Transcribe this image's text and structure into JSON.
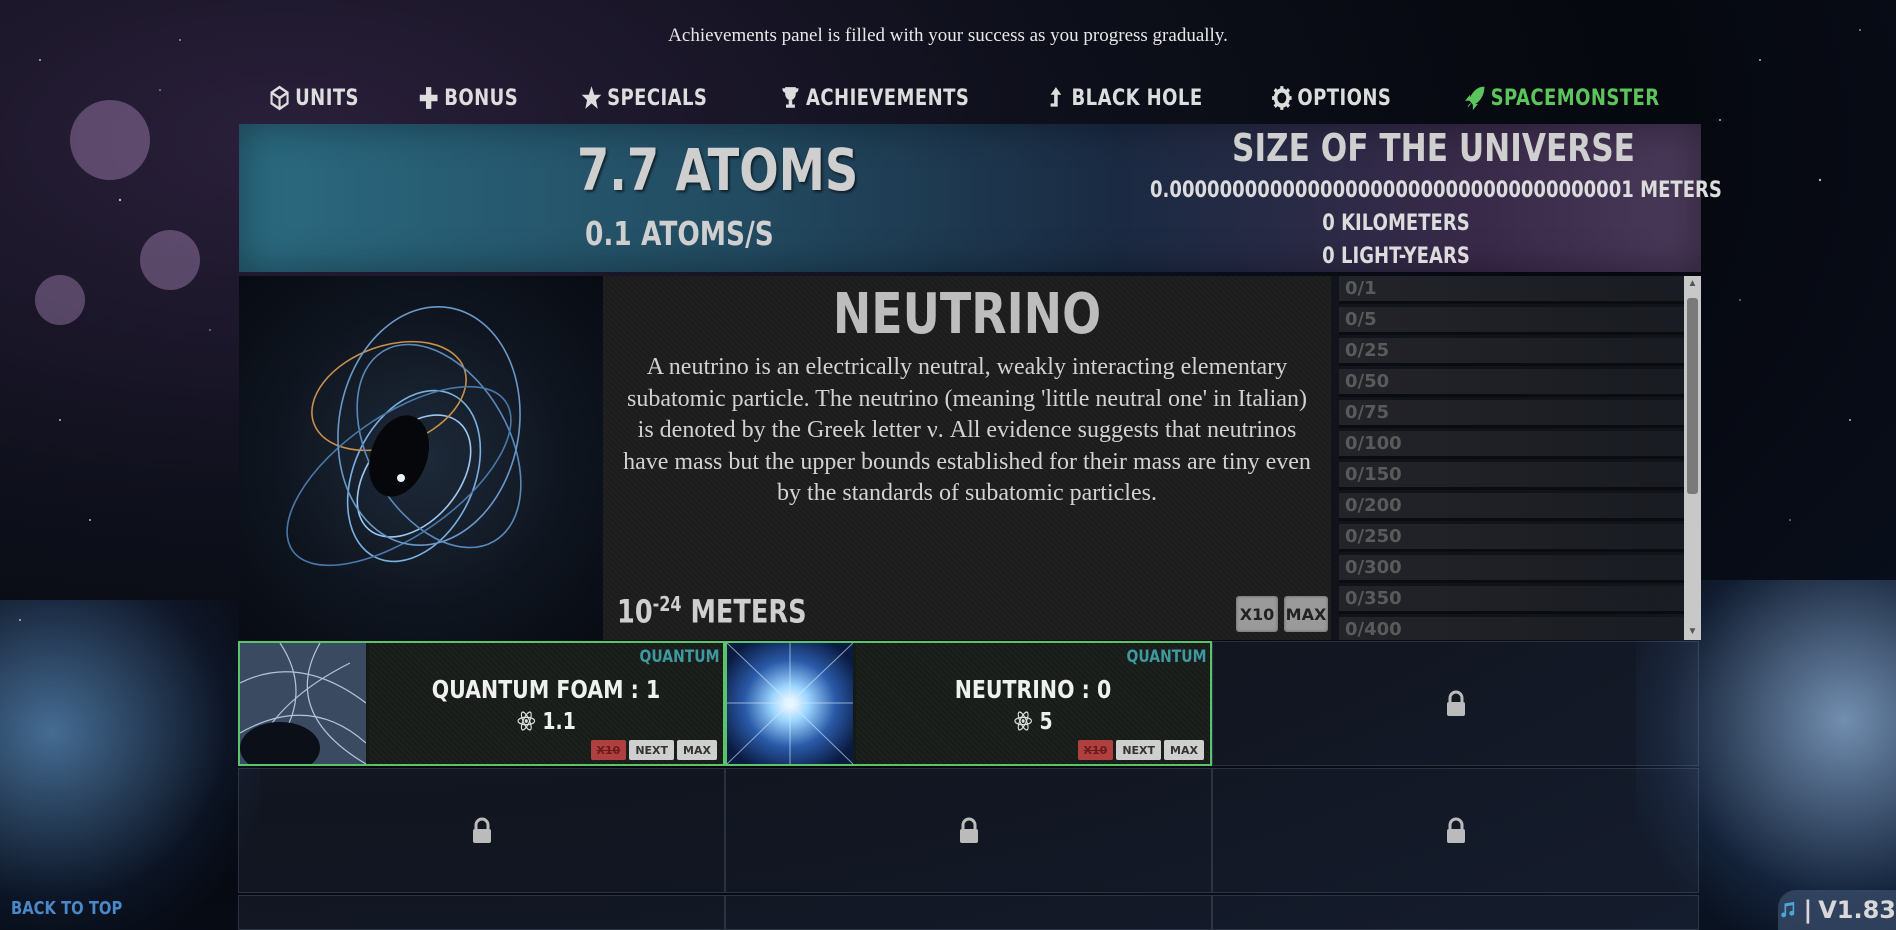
{
  "notice": "Achievements panel is filled with your success as you progress gradually.",
  "nav": {
    "units": "UNITS",
    "bonus": "BONUS",
    "specials": "SPECIALS",
    "achievements": "ACHIEVEMENTS",
    "black_hole": "BLACK HOLE",
    "options": "OPTIONS",
    "spacemonster": "SPACEMONSTER",
    "active_color": "#5cc45c"
  },
  "stats": {
    "atoms": "7.7 ATOMS",
    "rate": "0.1 ATOMS/S"
  },
  "universe": {
    "title": "SIZE OF THE UNIVERSE",
    "meters": "0.0000000000000000000000000000000000001 METERS",
    "kilometers": "0 KILOMETERS",
    "light_years": "0 LIGHT-YEARS"
  },
  "unit": {
    "title": "NEUTRINO",
    "description": "A neutrino is an electrically neutral, weakly interacting elementary subatomic particle. The neutrino (meaning 'little neutral one' in Italian) is denoted by the Greek letter ν. All evidence suggests that neutrinos have mass but the upper bounds established for their mass are tiny even by the standards of subatomic particles.",
    "size_base": "10",
    "size_exp": "-24",
    "size_unit": "METERS",
    "btn_x10": "X10",
    "btn_max": "MAX"
  },
  "achievements": [
    "0/1",
    "0/5",
    "0/25",
    "0/50",
    "0/75",
    "0/100",
    "0/150",
    "0/200",
    "0/250",
    "0/300",
    "0/350",
    "0/400"
  ],
  "cards": [
    {
      "category": "QUANTUM",
      "name": "QUANTUM FOAM : 1",
      "cost": "1.1",
      "x10": "X10",
      "next": "NEXT",
      "max": "MAX",
      "image": "quantum-foam-image"
    },
    {
      "category": "QUANTUM",
      "name": "NEUTRINO : 0",
      "cost": "5",
      "x10": "X10",
      "next": "NEXT",
      "max": "MAX",
      "image": "neutrino-burst-image"
    }
  ],
  "back_to_top": "BACK TO TOP",
  "version": "V1.83",
  "version_sep": "|",
  "icons": {
    "units": "cube-icon",
    "bonus": "plus-icon",
    "specials": "star-icon",
    "achievements": "trophy-icon",
    "black_hole": "arrow-up-icon",
    "options": "gear-icon",
    "spacemonster": "rocket-icon",
    "atom": "atom-icon",
    "lock": "lock-icon",
    "music": "music-icon"
  }
}
